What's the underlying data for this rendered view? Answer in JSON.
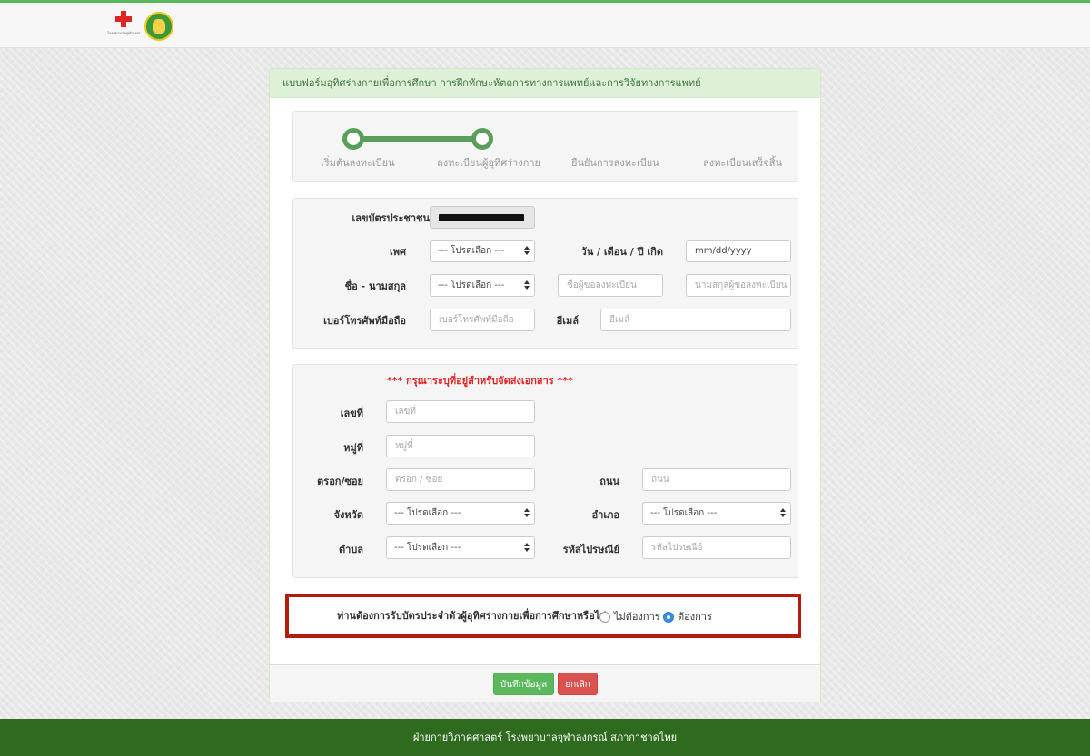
{
  "header": {
    "cross_logo_text": "โรงพยาบาลจุฬาลงกรณ์ สภากาชาดไทย",
    "seal_logo": "university-seal-icon"
  },
  "form": {
    "title": "แบบฟอร์มอุทิศร่างกายเพื่อการศึกษา การฝึกทักษะหัตถการทางการแพทย์และการวิจัยทางการแพทย์",
    "progress": {
      "completed_steps": 2,
      "steps": [
        "เริ่มต้นลงทะเบียน",
        "ลงทะเบียนผู้อุทิศร่างกาย",
        "ยืนยันการลงทะเบียน",
        "ลงทะเบียนเสร็จสิ้น"
      ]
    },
    "personal": {
      "id_label": "เลขบัตรประชาชน",
      "id_value_redacted": true,
      "gender_label": "เพศ",
      "gender_value": "--- โปรดเลือก ---",
      "dob_label": "วัน / เดือน / ปี เกิด",
      "dob_placeholder": "mm/dd/yyyy",
      "name_label": "ชื่อ - นามสกุล",
      "title_value": "--- โปรดเลือก ---",
      "firstname_placeholder": "ชื่อผู้ขอลงทะเบียน",
      "lastname_placeholder": "นามสกุลผู้ขอลงทะเบียน",
      "phone_label": "เบอร์โทรศัพท์มือถือ",
      "phone_placeholder": "เบอร์โทรศัพท์มือถือ",
      "email_label": "อีเมล์",
      "email_placeholder": "อีเมล์"
    },
    "address": {
      "note": "*** กรุณาระบุที่อยู่สำหรับจัดส่งเอกสาร ***",
      "house_no_label": "เลขที่",
      "house_no_placeholder": "เลขที่",
      "moo_label": "หมู่ที่",
      "moo_placeholder": "หมู่ที่",
      "soi_label": "ตรอก/ซอย",
      "soi_placeholder": "ตรอก / ซอย",
      "road_label": "ถนน",
      "road_placeholder": "ถนน",
      "province_label": "จังหวัด",
      "province_value": "--- โปรดเลือก ---",
      "district_label": "อำเภอ",
      "district_value": "--- โปรดเลือก ---",
      "subdistrict_label": "ตำบล",
      "subdistrict_value": "--- โปรดเลือก ---",
      "postcode_label": "รหัสไปรษณีย์",
      "postcode_placeholder": "รหัสไปรษณีย์"
    },
    "card_question": {
      "label": "ท่านต้องการรับบัตรประจำตัวผู้อุทิศร่างกายเพื่อการศึกษาหรือไม่",
      "option_no": "ไม่ต้องการ",
      "option_yes": "ต้องการ",
      "selected": "ต้องการ"
    },
    "buttons": {
      "save": "บันทึกข้อมูล",
      "cancel": "ยกเลิก"
    }
  },
  "footer": {
    "text": "ฝ่ายกายวิภาคศาสตร์ โรงพยาบาลจุฬาลงกรณ์ สภากาชาดไทย"
  },
  "colors": {
    "accent": "#5cb85c",
    "footer_bg": "#2f6b1f",
    "danger": "#d9534f",
    "highlight_border": "#b31b0e",
    "note_red": "#e02424"
  }
}
